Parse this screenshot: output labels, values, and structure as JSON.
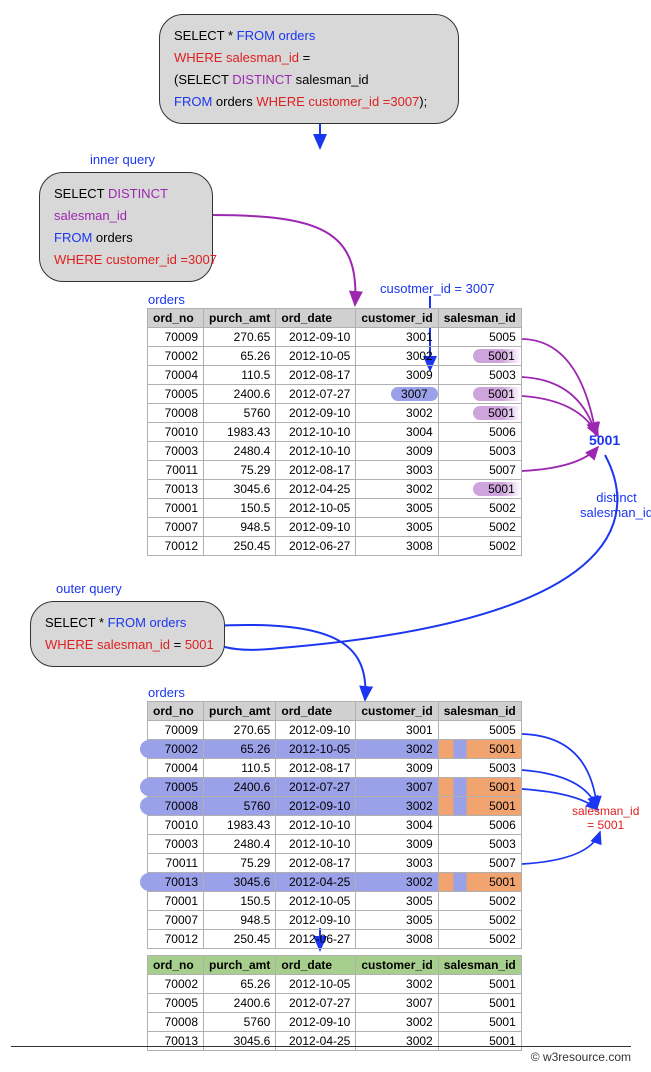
{
  "chart_data": {
    "type": "table",
    "description": "SQL subquery diagram: orders table filtered by salesman_id derived from customer_id 3007",
    "inner_query": "SELECT DISTINCT salesman_id FROM orders WHERE customer_id = 3007",
    "inner_result_salesman_id": 5001,
    "outer_query": "SELECT * FROM orders WHERE salesman_id = 5001",
    "orders_columns": [
      "ord_no",
      "purch_amt",
      "ord_date",
      "customer_id",
      "salesman_id"
    ],
    "orders_rows": [
      [
        70009,
        270.65,
        "2012-09-10",
        3001,
        5005
      ],
      [
        70002,
        65.26,
        "2012-10-05",
        3002,
        5001
      ],
      [
        70004,
        110.5,
        "2012-08-17",
        3009,
        5003
      ],
      [
        70005,
        2400.6,
        "2012-07-27",
        3007,
        5001
      ],
      [
        70008,
        5760,
        "2012-09-10",
        3002,
        5001
      ],
      [
        70010,
        1983.43,
        "2012-10-10",
        3004,
        5006
      ],
      [
        70003,
        2480.4,
        "2012-10-10",
        3009,
        5003
      ],
      [
        70011,
        75.29,
        "2012-08-17",
        3003,
        5007
      ],
      [
        70013,
        3045.6,
        "2012-04-25",
        3002,
        5001
      ],
      [
        70001,
        150.5,
        "2012-10-05",
        3005,
        5002
      ],
      [
        70007,
        948.5,
        "2012-09-10",
        3005,
        5002
      ],
      [
        70012,
        250.45,
        "2012-06-27",
        3008,
        5002
      ]
    ],
    "result_rows": [
      [
        70002,
        65.26,
        "2012-10-05",
        3002,
        5001
      ],
      [
        70005,
        2400.6,
        "2012-07-27",
        3007,
        5001
      ],
      [
        70008,
        5760,
        "2012-09-10",
        3002,
        5001
      ],
      [
        70013,
        3045.6,
        "2012-04-25",
        3002,
        5001
      ]
    ]
  },
  "main_sql": {
    "l1a": "SELECT * ",
    "l1b": "FROM orders",
    "l2a": "WHERE salesman_id ",
    "l2b": "=",
    "l3a": "(",
    "l3b": "SELECT ",
    "l3c": "DISTINCT",
    "l3d": " salesman_id",
    "l4a": "FROM ",
    "l4b": "orders ",
    "l4c": "WHERE customer_id =3007",
    "l4d": ");"
  },
  "inner_label": "inner query",
  "inner_sql": {
    "l1a": "SELECT ",
    "l1b": "DISTINCT",
    "l2": "salesman_id",
    "l3a": "FROM ",
    "l3b": "orders",
    "l4": "WHERE customer_id =3007"
  },
  "outer_label": "outer query",
  "outer_sql": {
    "l1a": "SELECT * ",
    "l1b": "FROM orders",
    "l2a": "WHERE salesman_id ",
    "l2b": "= ",
    "l2c": "5001"
  },
  "orders_title": "orders",
  "col": {
    "ord": "ord_no",
    "amt": "purch_amt",
    "date": "ord_date",
    "cust": "customer_id",
    "sales": "salesman_id"
  },
  "t1": {
    "r": [
      {
        "o": "70009",
        "a": "270.65",
        "d": "2012-09-10",
        "c": "3001",
        "s": "5005",
        "hl": false,
        "cust_hl": false
      },
      {
        "o": "70002",
        "a": "65.26",
        "d": "2012-10-05",
        "c": "3002",
        "s": "5001",
        "hl": true,
        "cust_hl": false
      },
      {
        "o": "70004",
        "a": "110.5",
        "d": "2012-08-17",
        "c": "3009",
        "s": "5003",
        "hl": false,
        "cust_hl": false
      },
      {
        "o": "70005",
        "a": "2400.6",
        "d": "2012-07-27",
        "c": "3007",
        "s": "5001",
        "hl": true,
        "cust_hl": true
      },
      {
        "o": "70008",
        "a": "5760",
        "d": "2012-09-10",
        "c": "3002",
        "s": "5001",
        "hl": true,
        "cust_hl": false
      },
      {
        "o": "70010",
        "a": "1983.43",
        "d": "2012-10-10",
        "c": "3004",
        "s": "5006",
        "hl": false,
        "cust_hl": false
      },
      {
        "o": "70003",
        "a": "2480.4",
        "d": "2012-10-10",
        "c": "3009",
        "s": "5003",
        "hl": false,
        "cust_hl": false
      },
      {
        "o": "70011",
        "a": "75.29",
        "d": "2012-08-17",
        "c": "3003",
        "s": "5007",
        "hl": false,
        "cust_hl": false
      },
      {
        "o": "70013",
        "a": "3045.6",
        "d": "2012-04-25",
        "c": "3002",
        "s": "5001",
        "hl": true,
        "cust_hl": false
      },
      {
        "o": "70001",
        "a": "150.5",
        "d": "2012-10-05",
        "c": "3005",
        "s": "5002",
        "hl": false,
        "cust_hl": false
      },
      {
        "o": "70007",
        "a": "948.5",
        "d": "2012-09-10",
        "c": "3005",
        "s": "5002",
        "hl": false,
        "cust_hl": false
      },
      {
        "o": "70012",
        "a": "250.45",
        "d": "2012-06-27",
        "c": "3008",
        "s": "5002",
        "hl": false,
        "cust_hl": false
      }
    ]
  },
  "t3": {
    "r": [
      {
        "o": "70002",
        "a": "65.26",
        "d": "2012-10-05",
        "c": "3002",
        "s": "5001"
      },
      {
        "o": "70005",
        "a": "2400.6",
        "d": "2012-07-27",
        "c": "3007",
        "s": "5001"
      },
      {
        "o": "70008",
        "a": "5760",
        "d": "2012-09-10",
        "c": "3002",
        "s": "5001"
      },
      {
        "o": "70013",
        "a": "3045.6",
        "d": "2012-04-25",
        "c": "3002",
        "s": "5001"
      }
    ]
  },
  "annot": {
    "cust_eq": "cusotmer_id = 3007",
    "distinct1": "distinct",
    "distinct2": "salesman_id",
    "val5001": "5001",
    "sales_eq1": "salesman_id",
    "sales_eq2": "= 5001"
  },
  "footer": "© w3resource.com"
}
